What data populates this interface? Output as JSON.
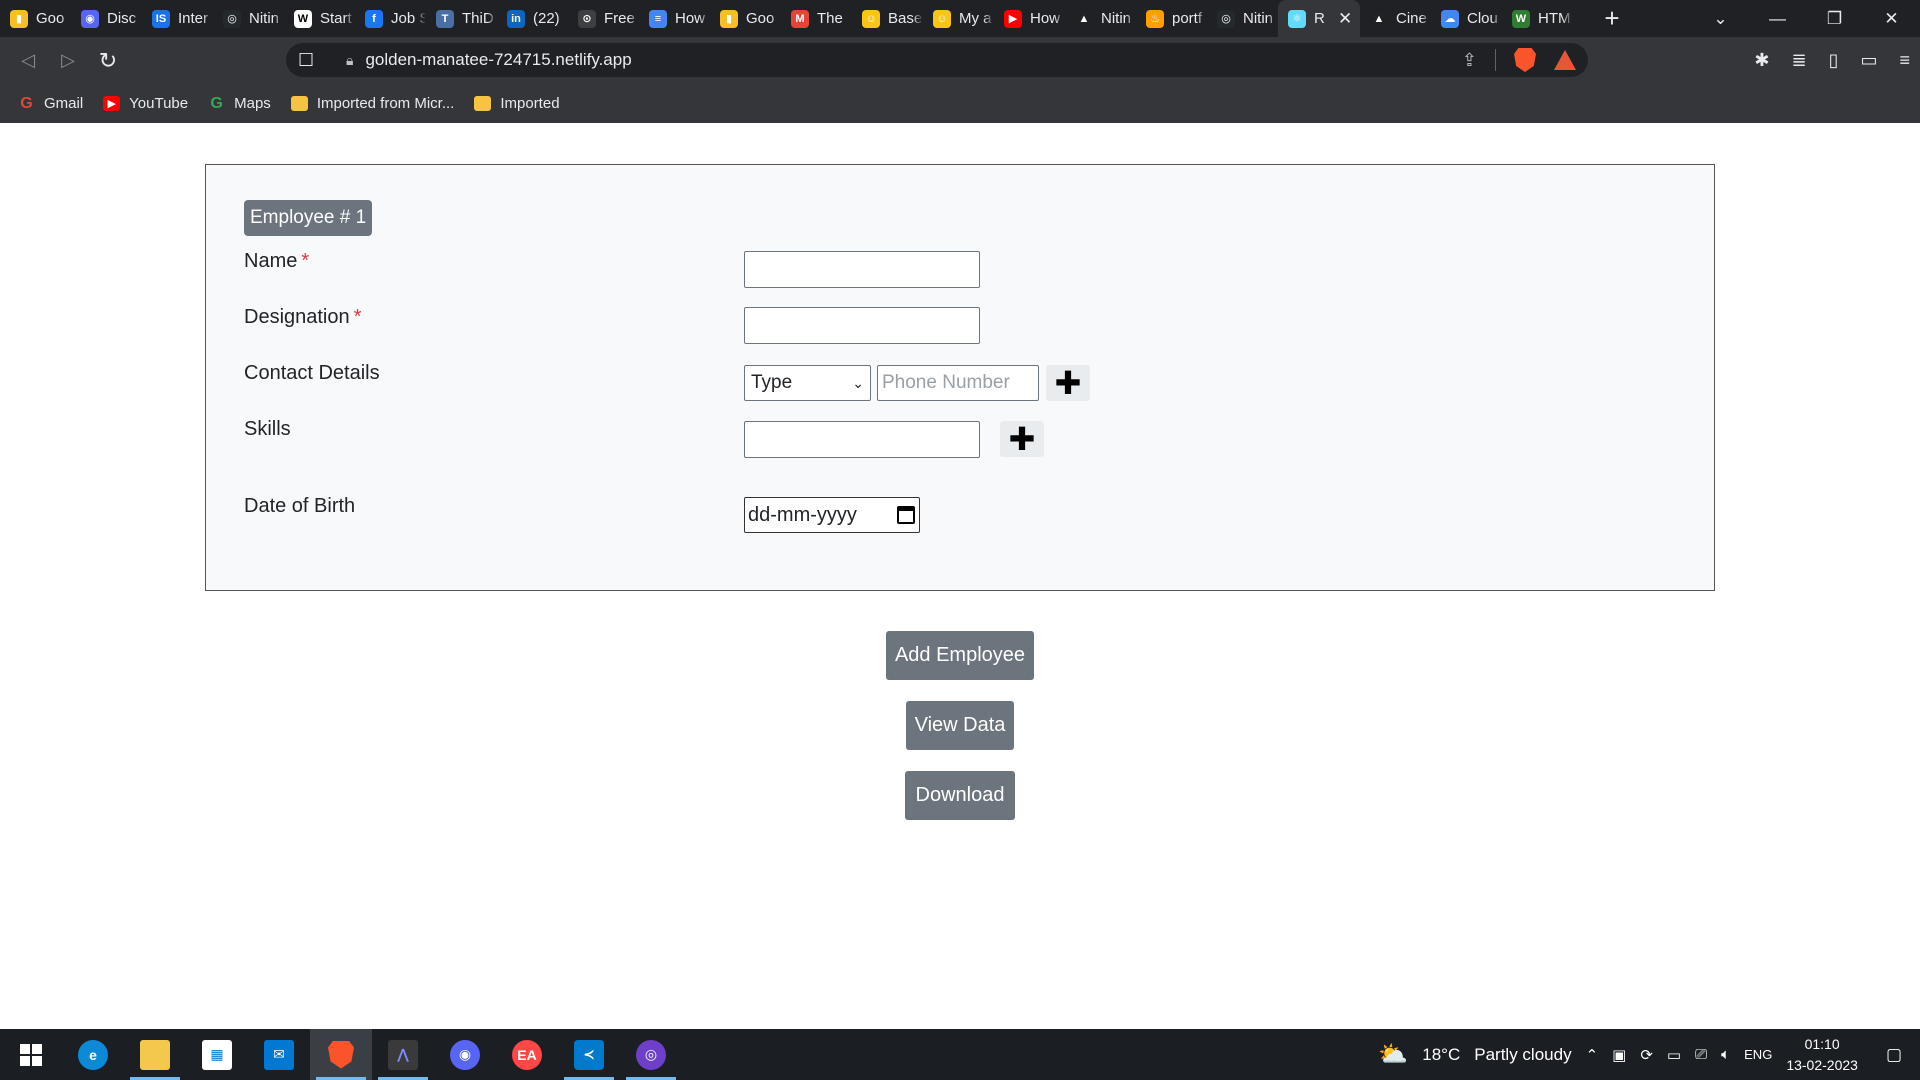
{
  "browser": {
    "tabs": [
      {
        "label": "Goo",
        "color": "#f6bf26",
        "glyph": "▮"
      },
      {
        "label": "Disc",
        "color": "#5865f2",
        "glyph": "◉"
      },
      {
        "label": "Inter",
        "color": "#1a73e8",
        "glyph": "IS"
      },
      {
        "label": "Nitin",
        "color": "#24292e",
        "glyph": "◎"
      },
      {
        "label": "Start",
        "color": "#ffffff",
        "glyph": "W"
      },
      {
        "label": "Job S",
        "color": "#1877f2",
        "glyph": "f"
      },
      {
        "label": "ThiD",
        "color": "#4a6fa5",
        "glyph": "T"
      },
      {
        "label": "(22)",
        "color": "#0a66c2",
        "glyph": "in"
      },
      {
        "label": "Free",
        "color": "#3c4043",
        "glyph": "⊙"
      },
      {
        "label": "How",
        "color": "#4285f4",
        "glyph": "≡"
      },
      {
        "label": "Goo",
        "color": "#f6bf26",
        "glyph": "▮"
      },
      {
        "label": "The",
        "color": "#ea4335",
        "glyph": "M"
      },
      {
        "label": "Base",
        "color": "#f9c513",
        "glyph": "☺"
      },
      {
        "label": "My a",
        "color": "#f9c513",
        "glyph": "☺"
      },
      {
        "label": "How",
        "color": "#ff0000",
        "glyph": "▶"
      },
      {
        "label": "Nitin",
        "color": "#202124",
        "glyph": "▲"
      },
      {
        "label": "portf",
        "color": "#ffa000",
        "glyph": "♨"
      },
      {
        "label": "Nitin",
        "color": "#24292e",
        "glyph": "◎"
      },
      {
        "label": "R",
        "color": "#61dafb",
        "glyph": "⚛",
        "active": true
      },
      {
        "label": "Cine",
        "color": "#202124",
        "glyph": "▲"
      },
      {
        "label": "Clou",
        "color": "#4285f4",
        "glyph": "☁"
      },
      {
        "label": "HTM",
        "color": "#2e7d32",
        "glyph": "W"
      }
    ],
    "url": "golden-manatee-724715.netlify.app",
    "bookmarks": [
      {
        "label": "Gmail",
        "icon": "google-icon",
        "color": "#ea4335",
        "glyph": "G"
      },
      {
        "label": "YouTube",
        "icon": "youtube-icon",
        "color": "#ff0000",
        "glyph": "▶"
      },
      {
        "label": "Maps",
        "icon": "google-icon",
        "color": "#34a853",
        "glyph": "G"
      },
      {
        "label": "Imported from Micr...",
        "icon": "folder-icon",
        "color": "#f6c342",
        "glyph": ""
      },
      {
        "label": "Imported",
        "icon": "folder-icon",
        "color": "#f6c342",
        "glyph": ""
      }
    ]
  },
  "form": {
    "employee_badge": "Employee # 1",
    "name_label": "Name",
    "designation_label": "Designation",
    "required_mark": "*",
    "contact_label": "Contact Details",
    "contact_type_selected": "Type",
    "phone_placeholder": "Phone Number",
    "skills_label": "Skills",
    "dob_label": "Date of Birth",
    "dob_placeholder": "dd-mm-yyyy",
    "plus_glyph": "✚"
  },
  "actions": {
    "add_employee": "Add Employee",
    "view_data": "View Data",
    "download": "Download"
  },
  "taskbar": {
    "weather_temp": "18°C",
    "weather_text": "Partly cloudy",
    "language": "ENG",
    "time": "01:10",
    "date": "13-02-2023"
  }
}
